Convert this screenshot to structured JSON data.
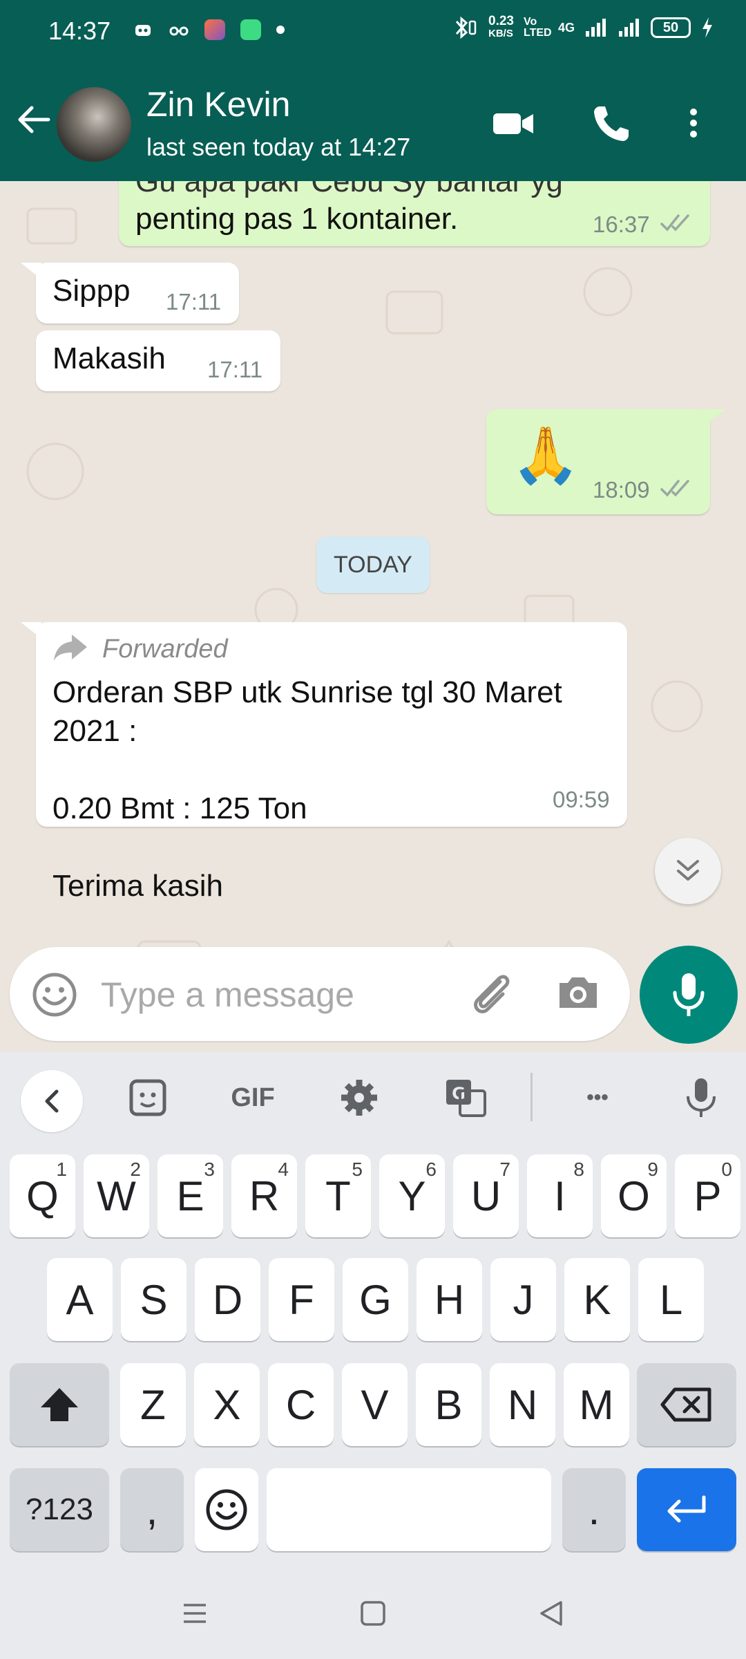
{
  "status_bar": {
    "time": "14:37",
    "speed_value": "0.23",
    "speed_unit": "KB/S",
    "volte": "Vo LTED",
    "network": "4G",
    "battery": "50"
  },
  "header": {
    "contact_name": "Zin Kevin",
    "last_seen": "last seen today at 14:27"
  },
  "messages": [
    {
      "direction": "out",
      "text_partial_top": "Gu apa pakr Cebu Sy bantar yg",
      "text": "penting pas 1 kontainer.",
      "time": "16:37",
      "read": true
    },
    {
      "direction": "in",
      "text": "Sippp",
      "time": "17:11"
    },
    {
      "direction": "in",
      "text": "Makasih",
      "time": "17:11"
    },
    {
      "direction": "out",
      "text": "🙏",
      "time": "18:09",
      "read": true
    }
  ],
  "date_chip": "TODAY",
  "forwarded_message": {
    "forwarded_label": "Forwarded",
    "line1": "Orderan SBP utk Sunrise tgl 30 Maret",
    "line2": "2021 :",
    "line3": "0.20 Bmt : 125 Ton",
    "line4": "Terima kasih",
    "time": "09:59"
  },
  "composer": {
    "placeholder": "Type a message"
  },
  "keyboard": {
    "toolbar": {
      "gif_label": "GIF",
      "more_label": "•••"
    },
    "row1": [
      {
        "k": "Q",
        "h": "1"
      },
      {
        "k": "W",
        "h": "2"
      },
      {
        "k": "E",
        "h": "3"
      },
      {
        "k": "R",
        "h": "4"
      },
      {
        "k": "T",
        "h": "5"
      },
      {
        "k": "Y",
        "h": "6"
      },
      {
        "k": "U",
        "h": "7"
      },
      {
        "k": "I",
        "h": "8"
      },
      {
        "k": "O",
        "h": "9"
      },
      {
        "k": "P",
        "h": "0"
      }
    ],
    "row2": [
      "A",
      "S",
      "D",
      "F",
      "G",
      "H",
      "J",
      "K",
      "L"
    ],
    "row3": [
      "Z",
      "X",
      "C",
      "V",
      "B",
      "N",
      "M"
    ],
    "symbols_label": "?123",
    "comma_label": ",",
    "period_label": "."
  },
  "colors": {
    "header": "#075e54",
    "outgoing_bubble": "#dcf8c6",
    "incoming_bubble": "#ffffff",
    "accent": "#00897b",
    "read_ticks": "#4fc3f7",
    "keyboard_enter": "#1a73e8"
  }
}
